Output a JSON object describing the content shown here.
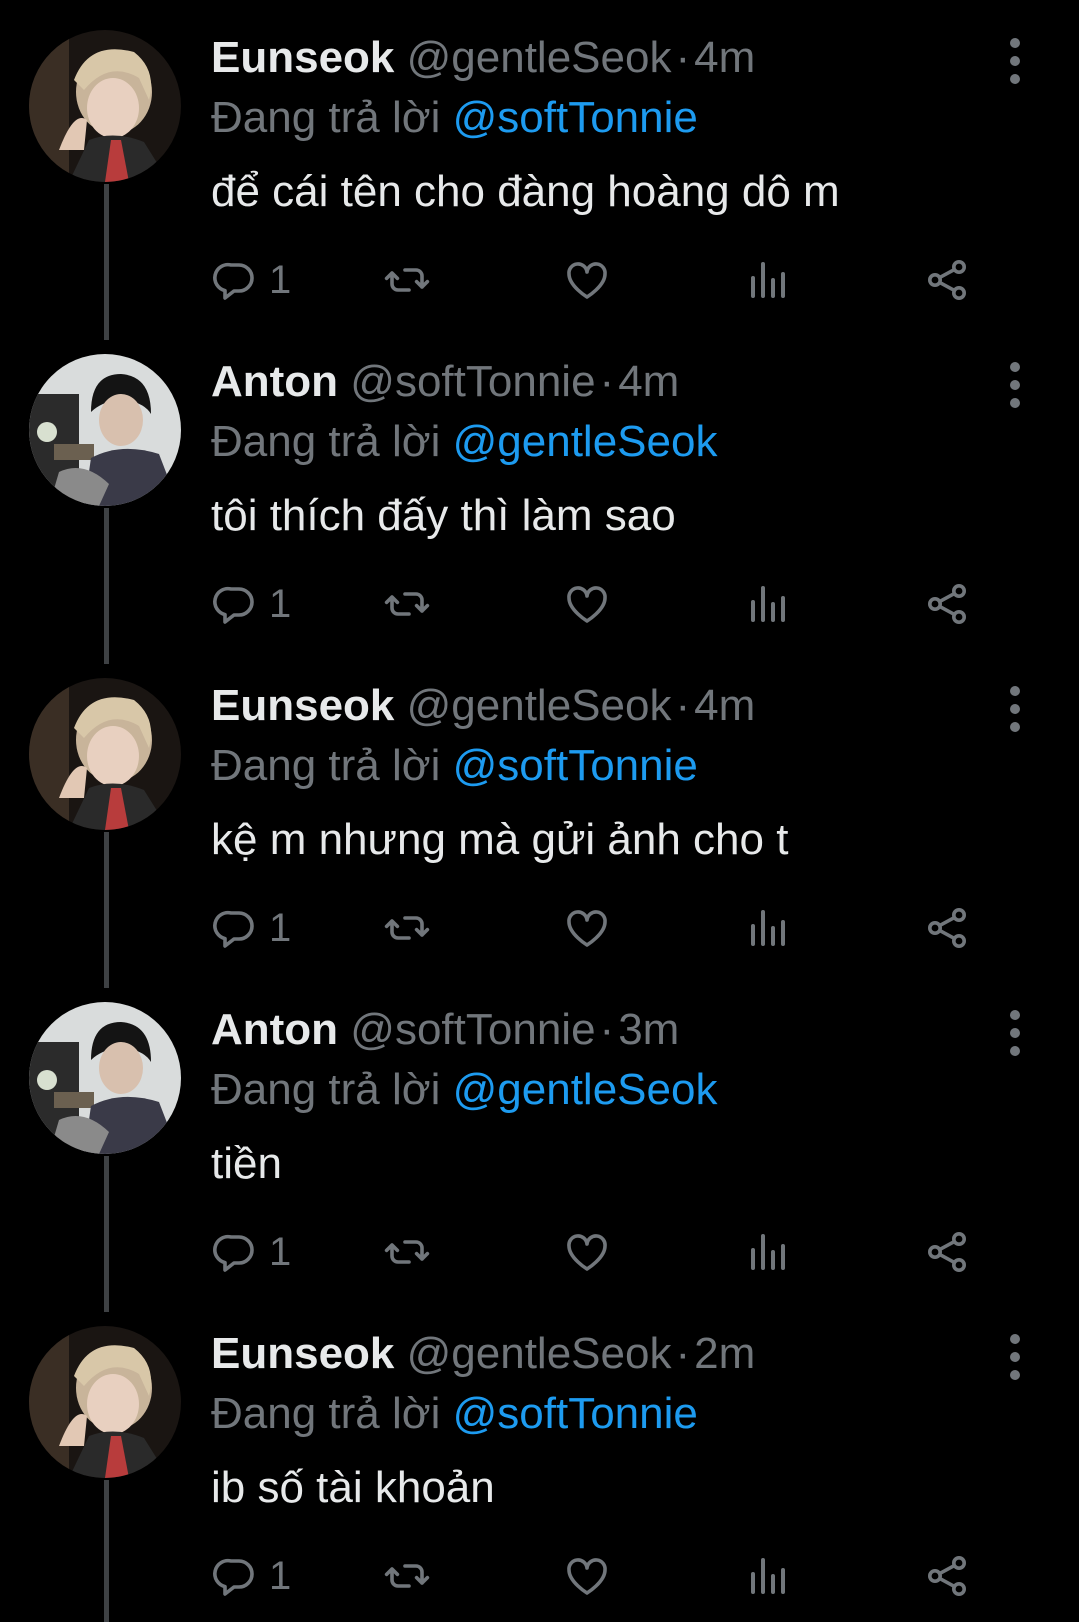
{
  "tweets": [
    {
      "name": "Eunseok",
      "handle": "@gentleSeok",
      "time": "4m",
      "reply_prefix": "Đang trả lời",
      "reply_to": "@softTonnie",
      "text": "để cái tên cho đàng hoàng dô m",
      "reply_count": "1",
      "avatar": "eunseok-avatar"
    },
    {
      "name": "Anton",
      "handle": "@softTonnie",
      "time": "4m",
      "reply_prefix": "Đang trả lời",
      "reply_to": "@gentleSeok",
      "text": "tôi thích đấy thì làm sao",
      "reply_count": "1",
      "avatar": "anton-avatar"
    },
    {
      "name": "Eunseok",
      "handle": "@gentleSeok",
      "time": "4m",
      "reply_prefix": "Đang trả lời",
      "reply_to": "@softTonnie",
      "text": "kệ m nhưng mà gửi ảnh cho t",
      "reply_count": "1",
      "avatar": "eunseok-avatar"
    },
    {
      "name": "Anton",
      "handle": "@softTonnie",
      "time": "3m",
      "reply_prefix": "Đang trả lời",
      "reply_to": "@gentleSeok",
      "text": "tiền",
      "reply_count": "1",
      "avatar": "anton-avatar"
    },
    {
      "name": "Eunseok",
      "handle": "@gentleSeok",
      "time": "2m",
      "reply_prefix": "Đang trả lời",
      "reply_to": "@softTonnie",
      "text": "ib số tài khoản",
      "reply_count": "1",
      "avatar": "eunseok-avatar"
    }
  ],
  "separator": "·",
  "colors": {
    "background": "#000000",
    "text": "#e7e9ea",
    "muted": "#71767b",
    "mention": "#1d9bf0",
    "thread_line": "#3e4144"
  },
  "icons": [
    "reply-icon",
    "retweet-icon",
    "like-icon",
    "views-icon",
    "share-icon",
    "more-icon"
  ]
}
